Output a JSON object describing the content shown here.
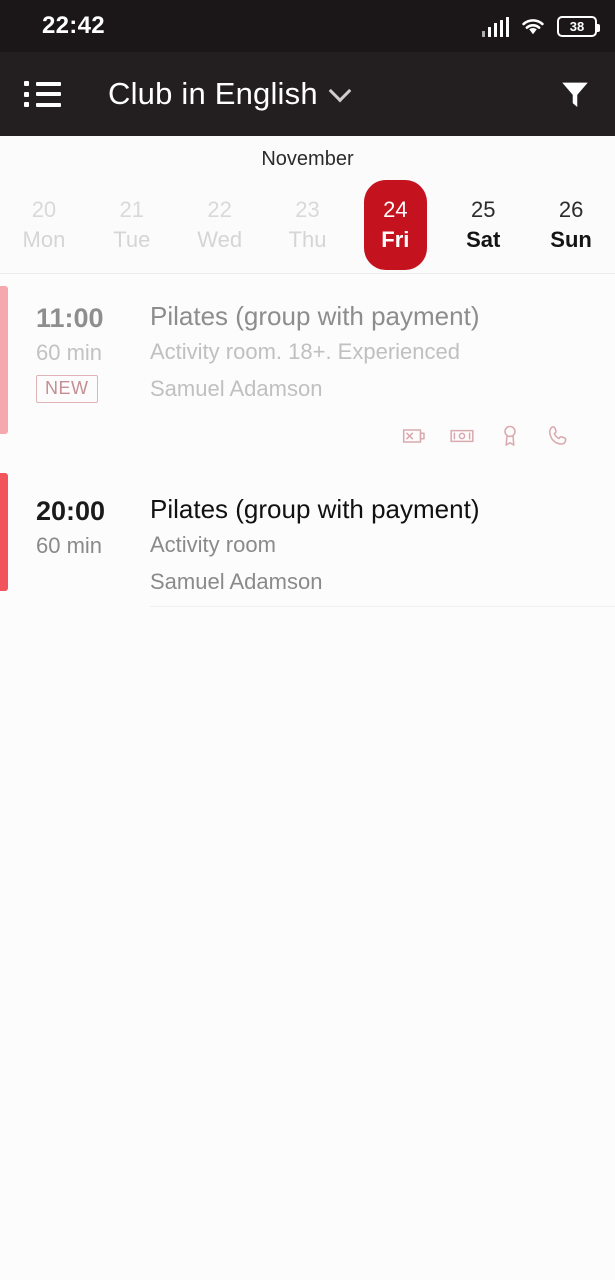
{
  "status_bar": {
    "time": "22:42",
    "battery_level": "38",
    "signal_icon": "signal-bars-icon",
    "wifi_icon": "wifi-icon",
    "battery_icon": "battery-icon"
  },
  "app_bar": {
    "menu_icon": "list-menu-icon",
    "title": "Club in English",
    "dropdown_icon": "chevron-down-icon",
    "filter_icon": "filter-funnel-icon"
  },
  "calendar": {
    "month": "November",
    "accent_color": "#c4121f",
    "days": [
      {
        "num": "20",
        "dow": "Mon",
        "state": "past"
      },
      {
        "num": "21",
        "dow": "Tue",
        "state": "past"
      },
      {
        "num": "22",
        "dow": "Wed",
        "state": "past"
      },
      {
        "num": "23",
        "dow": "Thu",
        "state": "past"
      },
      {
        "num": "24",
        "dow": "Fri",
        "state": "selected"
      },
      {
        "num": "25",
        "dow": "Sat",
        "state": "normal"
      },
      {
        "num": "26",
        "dow": "Sun",
        "state": "normal"
      }
    ]
  },
  "events": [
    {
      "time": "11:00",
      "duration": "60 min",
      "badge": "NEW",
      "title": "Pilates (group with payment)",
      "subtitle": "Activity room. 18+. Experienced",
      "coach": "Samuel Adamson",
      "accent_color": "#f5a8ad",
      "state": "faded",
      "icons": [
        "card-payment-disabled-icon",
        "cash-banknote-icon",
        "award-medal-icon",
        "phone-handset-icon"
      ]
    },
    {
      "time": "20:00",
      "duration": "60 min",
      "badge": "",
      "title": "Pilates (group with payment)",
      "subtitle": "Activity room",
      "coach": "Samuel Adamson",
      "accent_color": "#f2545b",
      "state": "active",
      "icons": []
    }
  ]
}
